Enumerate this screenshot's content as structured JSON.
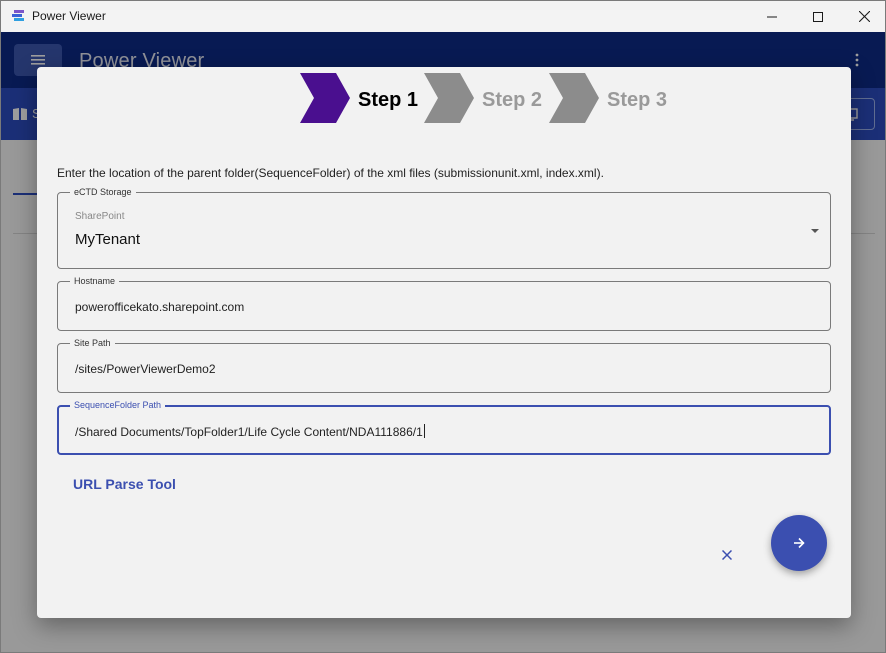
{
  "window": {
    "title": "Power Viewer"
  },
  "appbar": {
    "title": "Power Viewer"
  },
  "subbar": {
    "left_text": "S"
  },
  "stepper": {
    "steps": [
      {
        "label": "Step 1",
        "state": "active",
        "color": "#4a0f8f"
      },
      {
        "label": "Step 2",
        "state": "inactive",
        "color": "#8c8c8c"
      },
      {
        "label": "Step 3",
        "state": "inactive",
        "color": "#8c8c8c"
      }
    ]
  },
  "dialog": {
    "instruction": "Enter the location of the parent folder(SequenceFolder) of the xml files (submissionunit.xml, index.xml).",
    "storage": {
      "legend": "eCTD Storage",
      "sub_label": "SharePoint",
      "value": "MyTenant"
    },
    "hostname": {
      "legend": "Hostname",
      "value": "powerofficekato.sharepoint.com"
    },
    "site_path": {
      "legend": "Site Path",
      "value": "/sites/PowerViewerDemo2"
    },
    "sequence_folder_path": {
      "legend": "SequenceFolder Path",
      "value": "/Shared Documents/TopFolder1/Life Cycle Content/NDA111886/1"
    },
    "url_parse_tool": "URL Parse Tool"
  },
  "icons": {
    "app": "power-viewer-logo-icon",
    "menu": "hamburger-menu-icon",
    "more": "more-vertical-icon",
    "book": "book-icon",
    "minimize": "minimize-icon",
    "maximize": "maximize-icon",
    "close": "close-icon",
    "dropdown": "dropdown-arrow-icon",
    "cancel": "cancel-x-icon",
    "next": "arrow-right-icon"
  },
  "colors": {
    "appbar": "#0d2a87",
    "subbar": "#2d4cc0",
    "primary": "#3b4fb0",
    "step_active": "#4a0f8f",
    "step_inactive": "#8c8c8c"
  }
}
